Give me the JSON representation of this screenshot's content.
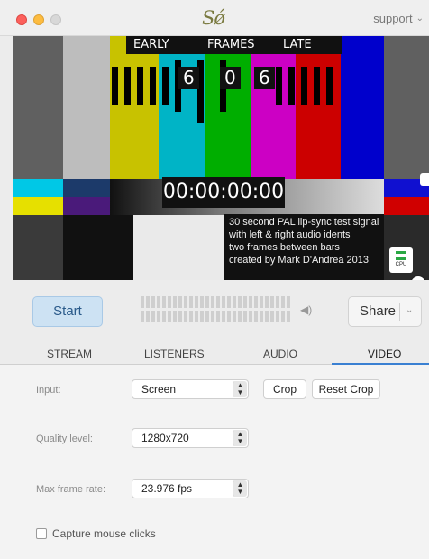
{
  "app": {
    "logo": "Sǿ",
    "account": "support",
    "account_chev": "⌄"
  },
  "preview": {
    "early": "EARLY",
    "frames": "FRAMES",
    "late": "LATE",
    "digits": [
      "6",
      "0",
      "6"
    ],
    "timecode": "00:00:00:00",
    "caption": [
      "30 second PAL lip-sync test signal",
      "with left & right audio idents",
      "two frames between bars",
      "created by Mark D'Andrea 2013"
    ],
    "cpu_label": "CPU",
    "bar_colors": [
      "#c0c0c0",
      "#c8c200",
      "#00b8c8",
      "#00b000",
      "#d000c8",
      "#d00000",
      "#0000d0"
    ]
  },
  "controls": {
    "start_label": "Start",
    "share_label": "Share",
    "share_chev": "⌄",
    "speaker": "◀)"
  },
  "tabs": [
    {
      "label": "STREAM"
    },
    {
      "label": "LISTENERS"
    },
    {
      "label": "AUDIO"
    },
    {
      "label": "VIDEO",
      "active": true
    }
  ],
  "video_panel": {
    "input_label": "Input:",
    "input_value": "Screen",
    "crop_label": "Crop",
    "reset_crop_label": "Reset Crop",
    "quality_label": "Quality level:",
    "quality_value": "1280x720",
    "framerate_label": "Max frame rate:",
    "framerate_value": "23.976 fps",
    "capture_label": "Capture mouse clicks",
    "capture_checked": false
  },
  "colors": {
    "accent": "#3a80d2",
    "start_bg": "#cde2f3"
  }
}
